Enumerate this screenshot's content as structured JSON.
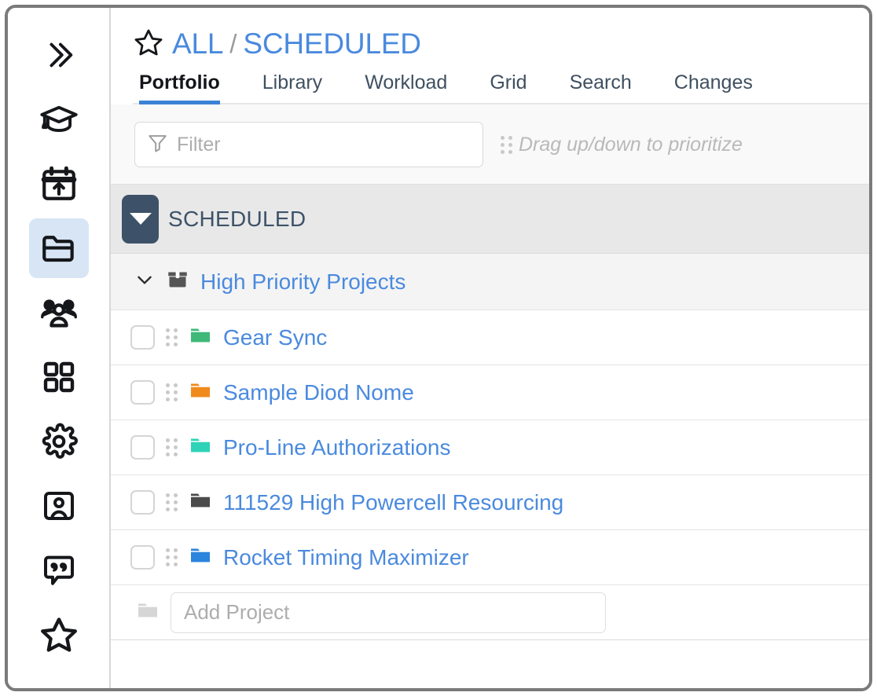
{
  "sidebar": {
    "items": [
      {
        "name": "expand-sidebar",
        "icon": "double-chevron-right-icon",
        "selected": false
      },
      {
        "name": "learning",
        "icon": "graduation-cap-icon",
        "selected": false
      },
      {
        "name": "schedule",
        "icon": "calendar-upload-icon",
        "selected": false
      },
      {
        "name": "projects",
        "icon": "folder-icon",
        "selected": true
      },
      {
        "name": "people",
        "icon": "people-group-icon",
        "selected": false
      },
      {
        "name": "apps",
        "icon": "grid-squares-icon",
        "selected": false
      },
      {
        "name": "settings",
        "icon": "gear-icon",
        "selected": false
      },
      {
        "name": "contacts",
        "icon": "contact-card-icon",
        "selected": false
      },
      {
        "name": "comments",
        "icon": "quote-bubble-icon",
        "selected": false
      },
      {
        "name": "favorites",
        "icon": "star-outline-icon",
        "selected": false
      }
    ]
  },
  "header": {
    "favorite_icon": "star-outline-icon",
    "breadcrumb": {
      "root": "ALL",
      "separator": "/",
      "current": "SCHEDULED"
    },
    "tabs": [
      {
        "label": "Portfolio",
        "active": true
      },
      {
        "label": "Library",
        "active": false
      },
      {
        "label": "Workload",
        "active": false
      },
      {
        "label": "Grid",
        "active": false
      },
      {
        "label": "Search",
        "active": false
      },
      {
        "label": "Changes",
        "active": false
      }
    ]
  },
  "toolbar": {
    "filter": {
      "icon": "funnel-icon",
      "placeholder": "Filter",
      "value": ""
    },
    "drag_hint": {
      "icon": "drag-handle-icon",
      "text": "Drag up/down to prioritize"
    }
  },
  "group": {
    "label": "SCHEDULED",
    "toggle_icon": "caret-down-icon",
    "expanded": true
  },
  "folder_group": {
    "chevron_icon": "chevron-down-icon",
    "box_icon": "archive-box-icon",
    "title": "High Priority Projects",
    "expanded": true
  },
  "projects": [
    {
      "name": "Gear Sync",
      "folder_color": "#3fb878",
      "checked": false
    },
    {
      "name": "Sample Diod Nome",
      "folder_color": "#f08a1c",
      "checked": false
    },
    {
      "name": "Pro-Line Authorizations",
      "folder_color": "#2ed3b7",
      "checked": false
    },
    {
      "name": "111529 High Powercell Resourcing",
      "folder_color": "#4b4b4b",
      "checked": false
    },
    {
      "name": "Rocket Timing Maximizer",
      "folder_color": "#2b84dd",
      "checked": false
    }
  ],
  "add_project": {
    "icon": "folder-icon",
    "placeholder": "Add Project",
    "value": ""
  },
  "colors": {
    "accent_blue": "#4a8ade",
    "tab_underline": "#3b82d6",
    "group_band": "#e8e8e8",
    "group_toggle": "#3d5268",
    "sidebar_selected": "#d7e5f5"
  }
}
